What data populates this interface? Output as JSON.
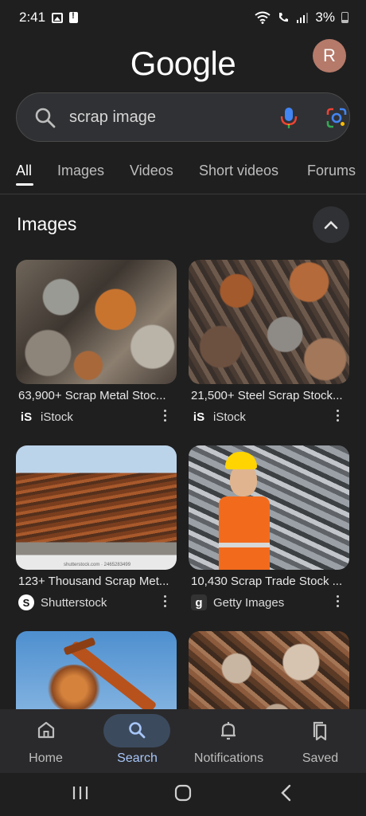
{
  "status_bar": {
    "time": "2:41",
    "battery": "3%"
  },
  "header": {
    "logo": "Google",
    "avatar_initial": "R"
  },
  "search": {
    "query": "scrap image"
  },
  "tabs": [
    {
      "label": "All",
      "active": true
    },
    {
      "label": "Images"
    },
    {
      "label": "Videos"
    },
    {
      "label": "Short videos"
    },
    {
      "label": "Forums"
    }
  ],
  "images_section": {
    "title": "Images",
    "results": [
      {
        "title": "63,900+ Scrap Metal Stoc...",
        "source": "iStock",
        "source_logo": "iS"
      },
      {
        "title": "21,500+ Steel Scrap Stock...",
        "source": "iStock",
        "source_logo": "iS"
      },
      {
        "title": "123+ Thousand Scrap Met...",
        "source": "Shutterstock",
        "source_logo": "S"
      },
      {
        "title": "10,430 Scrap Trade Stock ...",
        "source": "Getty Images",
        "source_logo": "g"
      },
      {
        "title": "",
        "source": "",
        "source_logo": ""
      },
      {
        "title": "",
        "source": "",
        "source_logo": ""
      }
    ]
  },
  "bottom_nav": [
    {
      "label": "Home",
      "icon": "home-icon"
    },
    {
      "label": "Search",
      "icon": "search-icon",
      "active": true
    },
    {
      "label": "Notifications",
      "icon": "bell-icon"
    },
    {
      "label": "Saved",
      "icon": "bookmark-icon"
    }
  ],
  "colors": {
    "background": "#1f1f1f",
    "accent": "#a8c7fa",
    "nav_pill": "#3c4a5e"
  }
}
